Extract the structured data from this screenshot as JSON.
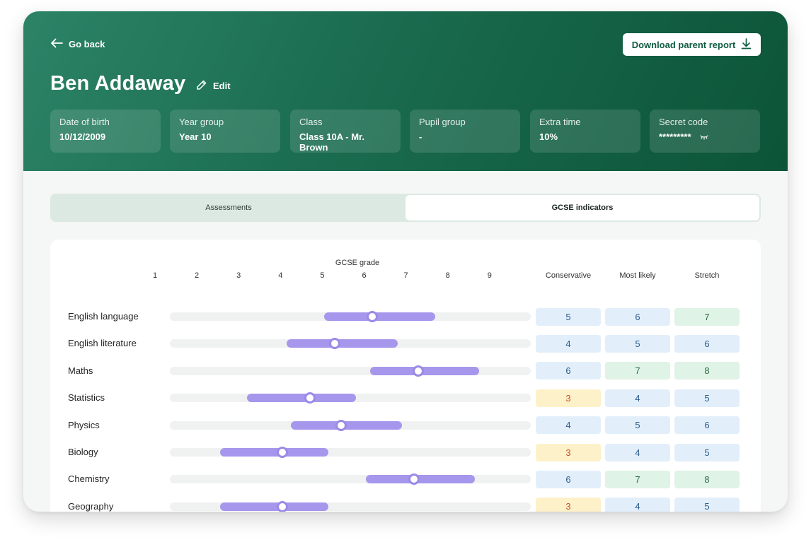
{
  "header": {
    "back_label": "Go back",
    "download_label": "Download parent report",
    "pupil_name": "Ben Addaway",
    "edit_label": "Edit"
  },
  "info": [
    {
      "label": "Date of birth",
      "value": "10/12/2009"
    },
    {
      "label": "Year group",
      "value": "Year 10"
    },
    {
      "label": "Class",
      "value": "Class 10A - Mr. Brown"
    },
    {
      "label": "Pupil group",
      "value": "-"
    },
    {
      "label": "Extra time",
      "value": "10%"
    },
    {
      "label": "Secret code",
      "value": "*********",
      "icon": "eye-closed-icon"
    }
  ],
  "tabs": [
    {
      "label": "Assessments",
      "active": false
    },
    {
      "label": "GCSE indicators",
      "active": true
    }
  ],
  "grid": {
    "grade_title": "GCSE grade",
    "grades": [
      "1",
      "2",
      "3",
      "4",
      "5",
      "6",
      "7",
      "8",
      "9"
    ],
    "columns": [
      "Conservative",
      "Most likely",
      "Stretch"
    ]
  },
  "subjects": [
    {
      "name": "English language",
      "low": 5.05,
      "estimate": 6.2,
      "high": 7.7,
      "cells": [
        {
          "value": "5",
          "color": "blue"
        },
        {
          "value": "6",
          "color": "blue"
        },
        {
          "value": "7",
          "color": "green"
        }
      ]
    },
    {
      "name": "English literature",
      "low": 4.15,
      "estimate": 5.3,
      "high": 6.8,
      "cells": [
        {
          "value": "4",
          "color": "blue"
        },
        {
          "value": "5",
          "color": "blue"
        },
        {
          "value": "6",
          "color": "blue"
        }
      ]
    },
    {
      "name": "Maths",
      "low": 6.15,
      "estimate": 7.3,
      "high": 8.75,
      "cells": [
        {
          "value": "6",
          "color": "blue"
        },
        {
          "value": "7",
          "color": "green"
        },
        {
          "value": "8",
          "color": "green"
        }
      ]
    },
    {
      "name": "Statistics",
      "low": 3.2,
      "estimate": 4.7,
      "high": 5.8,
      "cells": [
        {
          "value": "3",
          "color": "yellow"
        },
        {
          "value": "4",
          "color": "blue"
        },
        {
          "value": "5",
          "color": "blue"
        }
      ]
    },
    {
      "name": "Physics",
      "low": 4.25,
      "estimate": 5.45,
      "high": 6.9,
      "cells": [
        {
          "value": "4",
          "color": "blue"
        },
        {
          "value": "5",
          "color": "blue"
        },
        {
          "value": "6",
          "color": "blue"
        }
      ]
    },
    {
      "name": "Biology",
      "low": 2.55,
      "estimate": 4.05,
      "high": 5.15,
      "cells": [
        {
          "value": "3",
          "color": "yellow"
        },
        {
          "value": "4",
          "color": "blue"
        },
        {
          "value": "5",
          "color": "blue"
        }
      ]
    },
    {
      "name": "Chemistry",
      "low": 6.05,
      "estimate": 7.2,
      "high": 8.65,
      "cells": [
        {
          "value": "6",
          "color": "blue"
        },
        {
          "value": "7",
          "color": "green"
        },
        {
          "value": "8",
          "color": "green"
        }
      ]
    },
    {
      "name": "Geography",
      "low": 2.55,
      "estimate": 4.05,
      "high": 5.15,
      "cells": [
        {
          "value": "3",
          "color": "yellow"
        },
        {
          "value": "4",
          "color": "blue"
        },
        {
          "value": "5",
          "color": "blue"
        }
      ]
    }
  ],
  "colors": {
    "brand": "#1a6b4f",
    "range": "#a697ec",
    "marker_ring": "#9b8ae6"
  }
}
